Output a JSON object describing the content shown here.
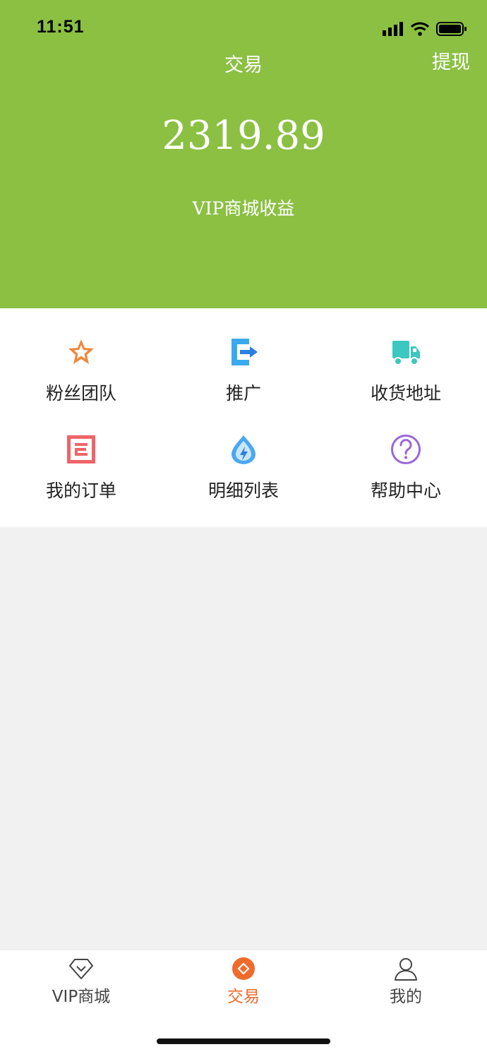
{
  "status_bar": {
    "time": "11:51"
  },
  "header": {
    "title": "交易",
    "action_label": "提现",
    "amount": "2319.89",
    "amount_label": "VIP商城收益",
    "background": "#8bc043"
  },
  "menu": [
    {
      "label": "粉丝团队",
      "icon": "star-icon",
      "color": "#f0883a"
    },
    {
      "label": "推广",
      "icon": "share-export-icon",
      "color": "#3aaaf0"
    },
    {
      "label": "收货地址",
      "icon": "delivery-truck-icon",
      "color": "#3cc7c0"
    },
    {
      "label": "我的订单",
      "icon": "order-list-icon",
      "color": "#ef6468"
    },
    {
      "label": "明细列表",
      "icon": "water-drop-bolt-icon",
      "color": "#4aa8f0"
    },
    {
      "label": "帮助中心",
      "icon": "question-circle-icon",
      "color": "#9b67d8"
    }
  ],
  "tabbar": {
    "active_color": "#f06a2c",
    "tabs": [
      {
        "label": "VIP商城",
        "icon": "diamond-icon",
        "active": false
      },
      {
        "label": "交易",
        "icon": "coin-icon",
        "active": true
      },
      {
        "label": "我的",
        "icon": "user-icon",
        "active": false
      }
    ]
  }
}
